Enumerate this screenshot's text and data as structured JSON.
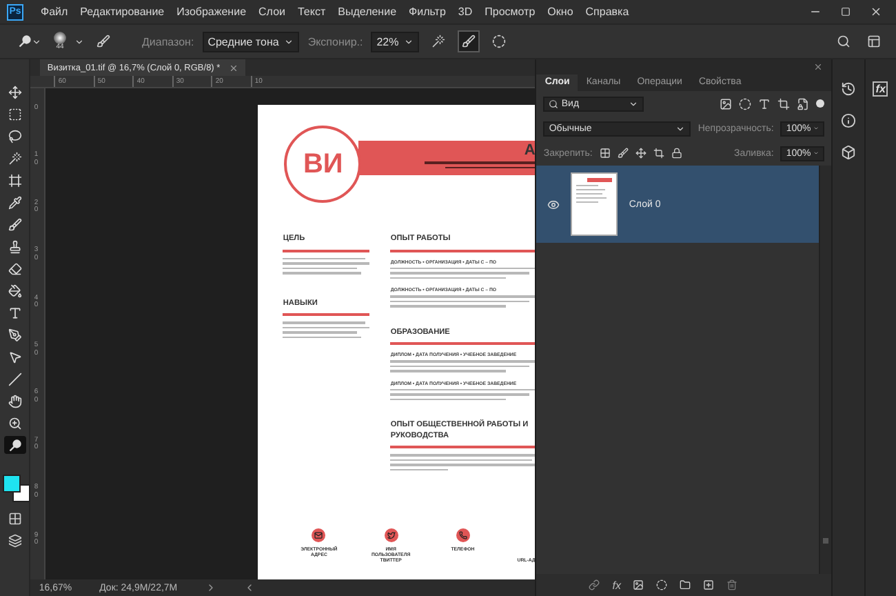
{
  "menu_bar": {
    "logo": "Ps",
    "items": [
      "Файл",
      "Редактирование",
      "Изображение",
      "Слои",
      "Текст",
      "Выделение",
      "Фильтр",
      "3D",
      "Просмотр",
      "Окно",
      "Справка"
    ]
  },
  "options_bar": {
    "brush_size": "44",
    "range_label": "Диапазон:",
    "range_value": "Средние тона",
    "exposure_label": "Экспонир.:",
    "exposure_value": "22%"
  },
  "document_tab": {
    "title": "Визитка_01.tif @ 16,7% (Слой 0, RGB/8) *"
  },
  "rulers": {
    "horizontal": [
      "60",
      "50",
      "40",
      "30",
      "20",
      "10"
    ],
    "vertical": [
      "0",
      "10",
      "20",
      "30",
      "40",
      "50",
      "60",
      "70",
      "80",
      "90"
    ]
  },
  "tools": [
    {
      "kind": "move",
      "selected": false
    },
    {
      "kind": "marquee",
      "selected": false
    },
    {
      "kind": "lasso",
      "selected": false
    },
    {
      "kind": "wand",
      "selected": false
    },
    {
      "kind": "frame",
      "selected": false
    },
    {
      "kind": "eyedropper",
      "selected": false
    },
    {
      "kind": "brush",
      "selected": false
    },
    {
      "kind": "stamp",
      "selected": false
    },
    {
      "kind": "eraser",
      "selected": false
    },
    {
      "kind": "bucket",
      "selected": false
    },
    {
      "kind": "type",
      "selected": false
    },
    {
      "kind": "pen",
      "selected": false
    },
    {
      "kind": "pointer",
      "selected": false
    },
    {
      "kind": "line",
      "selected": false
    },
    {
      "kind": "hand",
      "selected": false
    },
    {
      "kind": "zoom",
      "selected": false
    },
    {
      "kind": "dodge",
      "selected": true
    }
  ],
  "swatches": [
    {
      "color": "#1fe3f0"
    },
    {
      "color": "#ffffff"
    }
  ],
  "resume": {
    "initials": "ВИ",
    "name": "А",
    "left_sections": [
      {
        "title": "ЦЕЛЬ"
      },
      {
        "title": "НАВЫКИ"
      }
    ],
    "right_sections": [
      {
        "title": "ОПЫТ РАБОТЫ",
        "entries": [
          "ДОЛЖНОСТЬ • ОРГАНИЗАЦИЯ • ДАТЫ С – ПО",
          "ДОЛЖНОСТЬ • ОРГАНИЗАЦИЯ • ДАТЫ С – ПО"
        ]
      },
      {
        "title": "ОБРАЗОВАНИЕ",
        "entries": [
          "ДИПЛОМ • ДАТА ПОЛУЧЕНИЯ • УЧЕБНОЕ ЗАВЕДЕНИЕ",
          "ДИПЛОМ • ДАТА ПОЛУЧЕНИЯ • УЧЕБНОЕ ЗАВЕДЕНИЕ"
        ]
      },
      {
        "title": "ОПЫТ ОБЩЕСТВЕННОЙ РАБОТЫ И РУКОВОДСТВА"
      }
    ],
    "contacts": [
      {
        "kind": "email",
        "label": "ЭЛЕКТРОННЫЙ АДРЕС"
      },
      {
        "kind": "twitter",
        "label": "ИМЯ ПОЛЬЗОВАТЕЛЯ ТВИТТЕР"
      },
      {
        "kind": "phone",
        "label": "ТЕЛЕФОН"
      },
      {
        "kind": "url",
        "label": "URL-АД"
      }
    ]
  },
  "status_bar": {
    "zoom": "16,67%",
    "document_size": "Док: 24,9M/22,7M"
  },
  "layers_panel": {
    "tabs": [
      {
        "label": "Слои",
        "selected": true
      },
      {
        "label": "Каналы",
        "selected": false
      },
      {
        "label": "Операции",
        "selected": false
      },
      {
        "label": "Свойства",
        "selected": false
      }
    ],
    "filter": "Вид",
    "blend_mode": "Обычные",
    "opacity_label": "Непрозрачность:",
    "opacity": "100%",
    "lock_label": "Закрепить:",
    "fill_label": "Заливка:",
    "fill": "100%",
    "layers": [
      {
        "name": "Слой 0",
        "visible": true,
        "selected": true
      }
    ],
    "effects": "fx"
  },
  "side_dock": {
    "effects": "fx"
  }
}
